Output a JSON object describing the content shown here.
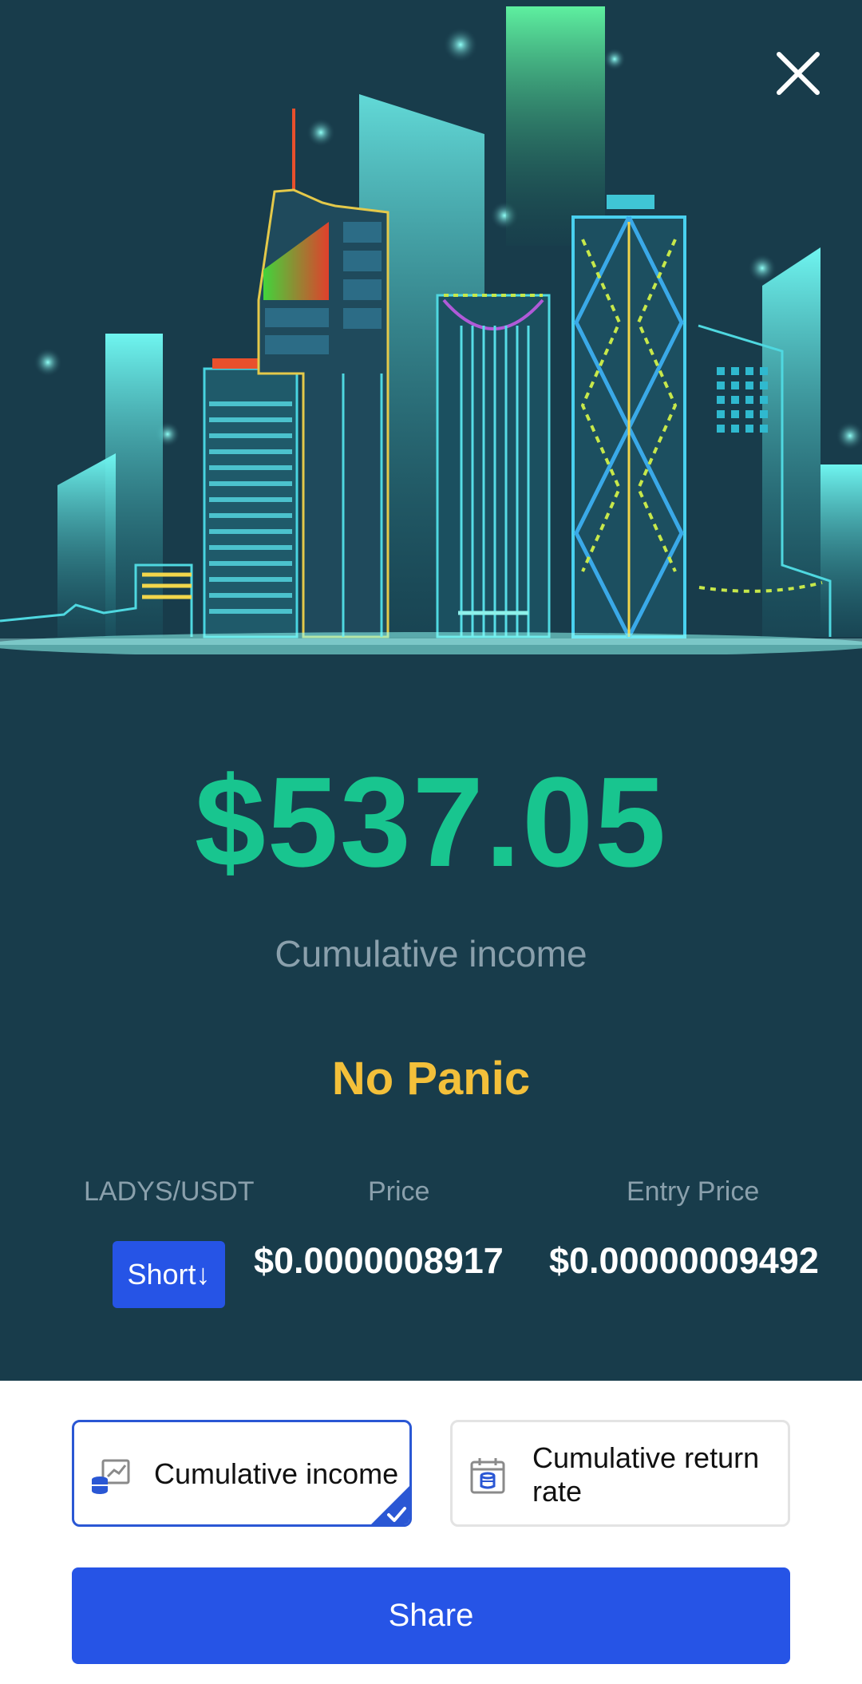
{
  "icons": {
    "close": "close-icon",
    "income_option": "coins-chart-icon",
    "return_option": "calendar-coins-icon",
    "selected_mark": "checkmark-icon"
  },
  "colors": {
    "background": "#183c4b",
    "amount": "#18c58f",
    "tagline": "#f3c03a",
    "accent": "#2654e6"
  },
  "summary": {
    "amount": "$537.05",
    "amount_label": "Cumulative income",
    "tagline": "No Panic"
  },
  "position": {
    "headers": {
      "pair": "LADYS/USDT",
      "price": "Price",
      "entry": "Entry Price"
    },
    "side": "Short↓",
    "price": "$0.0000008917",
    "entry_price": "$0.00000009492"
  },
  "options": [
    {
      "label": "Cumulative income",
      "selected": true
    },
    {
      "label": "Cumulative return rate",
      "selected": false
    }
  ],
  "share_label": "Share"
}
